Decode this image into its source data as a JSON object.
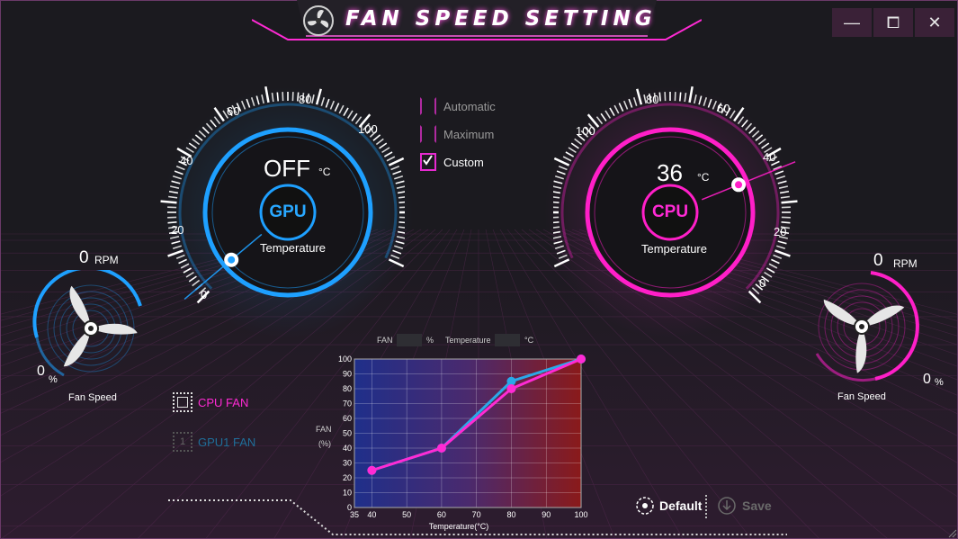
{
  "window": {
    "title": "FAN SPEED SETTING",
    "controls": {
      "minimize": "—",
      "maximize": "⧠",
      "close": "✕"
    }
  },
  "gpu": {
    "temperature_value": "OFF",
    "temperature_unit": "°C",
    "badge": "GPU",
    "caption": "Temperature",
    "scale_ticks": [
      "0",
      "20",
      "40",
      "60",
      "80",
      "100"
    ],
    "rpm_value": "0",
    "rpm_unit": "RPM",
    "fan_percent": "0",
    "percent_unit": "%",
    "fan_caption": "Fan Speed",
    "color": "#1ea0ff"
  },
  "cpu": {
    "temperature_value": "36",
    "temperature_unit": "°C",
    "badge": "CPU",
    "caption": "Temperature",
    "scale_ticks": [
      "0",
      "20",
      "40",
      "60",
      "80",
      "100"
    ],
    "rpm_value": "0",
    "rpm_unit": "RPM",
    "fan_percent": "0",
    "percent_unit": "%",
    "fan_caption": "Fan Speed",
    "color": "#ff1fc8"
  },
  "modes": [
    {
      "label": "Automatic",
      "checked": false
    },
    {
      "label": "Maximum",
      "checked": false
    },
    {
      "label": "Custom",
      "checked": true
    }
  ],
  "fan_selector": {
    "cpu_fan": "CPU FAN",
    "gpu_fan": "GPU1 FAN",
    "gpu_chip_number": "1"
  },
  "curve_editor": {
    "fan_label": "FAN",
    "fan_unit": "%",
    "temperature_label": "Temperature",
    "temperature_unit": "°C",
    "y_title_line1": "FAN",
    "y_title_line2": "(%)",
    "x_title": "Temperature(°C)"
  },
  "chart_data": {
    "type": "line",
    "xlabel": "Temperature(°C)",
    "ylabel": "FAN (%)",
    "x_ticks": [
      35,
      40,
      50,
      60,
      70,
      80,
      90,
      100
    ],
    "y_ticks": [
      0,
      10,
      20,
      30,
      40,
      50,
      60,
      70,
      80,
      90,
      100
    ],
    "xlim": [
      35,
      100
    ],
    "ylim": [
      0,
      100
    ],
    "grid": true,
    "series": [
      {
        "color": "#2aa8e8",
        "x": [
          40,
          60,
          80,
          100
        ],
        "y": [
          25,
          40,
          85,
          100
        ]
      },
      {
        "color": "#ff2ad4",
        "x": [
          40,
          60,
          80,
          100
        ],
        "y": [
          25,
          40,
          80,
          100
        ]
      }
    ]
  },
  "actions": {
    "default": "Default",
    "save": "Save"
  }
}
